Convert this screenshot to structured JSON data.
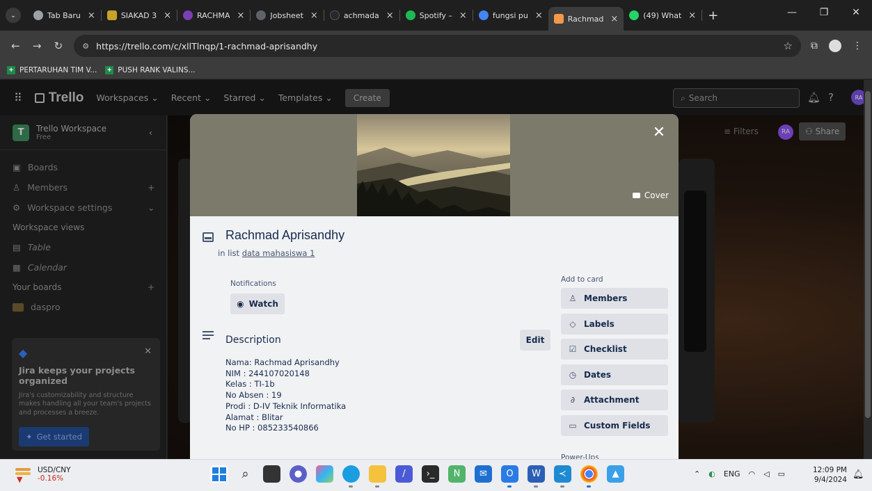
{
  "browser": {
    "tabs": [
      {
        "title": "Tab Baru",
        "color": "#9aa0a6"
      },
      {
        "title": "SIAKAD 3",
        "color": "#c9a227"
      },
      {
        "title": "RACHMA",
        "color": "#7b3fb3"
      },
      {
        "title": "Jobsheet",
        "color": "#5f6368"
      },
      {
        "title": "achmada",
        "color": "#24292f"
      },
      {
        "title": "Spotify –",
        "color": "#1db954"
      },
      {
        "title": "fungsi pu",
        "color": "#4285f4"
      },
      {
        "title": "Rachmad",
        "color": "#f2994a"
      },
      {
        "title": "(49) What",
        "color": "#25d366"
      }
    ],
    "url": "https://trello.com/c/xllTlnqp/1-rachmad-aprisandhy",
    "bookmarks": [
      "PERTARUHAN TIM V...",
      "PUSH RANK VALINS..."
    ]
  },
  "trello": {
    "logo": "Trello",
    "nav": [
      "Workspaces",
      "Recent",
      "Starred",
      "Templates"
    ],
    "create": "Create",
    "search_placeholder": "Search",
    "avatar": "RA",
    "workspace": {
      "name": "Trello Workspace",
      "plan": "Free",
      "badge": "T"
    },
    "sidebar": {
      "items": [
        "Boards",
        "Members",
        "Workspace settings"
      ],
      "views_label": "Workspace views",
      "views": [
        "Table",
        "Calendar"
      ],
      "boards_label": "Your boards",
      "boards": [
        "daspro"
      ]
    },
    "jira": {
      "title": "Jira keeps your projects organized",
      "text": "Jira's customizability and structure makes handling all your team's projects and processes a breeze.",
      "button": "Get started"
    },
    "board_header": {
      "filters": "Filters",
      "share": "Share",
      "badge": "RA"
    }
  },
  "card": {
    "title": "Rachmad Aprisandhy",
    "in_list_prefix": "in list",
    "list_name": "data mahasiswa 1",
    "cover_label": "Cover",
    "notifications_label": "Notifications",
    "watch_label": "Watch",
    "description_label": "Description",
    "edit_label": "Edit",
    "description_lines": [
      "Nama: Rachmad Aprisandhy",
      "NIM : 244107020148",
      "Kelas : TI-1b",
      "No Absen : 19",
      "Prodi : D-IV Teknik Informatika",
      "Alamat : Blitar",
      "No HP : 085233540866"
    ],
    "add_to_card_label": "Add to card",
    "add_to_card": [
      {
        "label": "Members",
        "icon": "person-icon"
      },
      {
        "label": "Labels",
        "icon": "tag-icon"
      },
      {
        "label": "Checklist",
        "icon": "checklist-icon"
      },
      {
        "label": "Dates",
        "icon": "clock-icon"
      },
      {
        "label": "Attachment",
        "icon": "paperclip-icon"
      },
      {
        "label": "Custom Fields",
        "icon": "custom-fields-icon"
      }
    ],
    "power_ups_label": "Power-Ups"
  },
  "taskbar": {
    "widget_title": "USD/CNY",
    "widget_change": "-0.16%",
    "lang": "ENG",
    "time": "12:09 PM",
    "date": "9/4/2024"
  }
}
